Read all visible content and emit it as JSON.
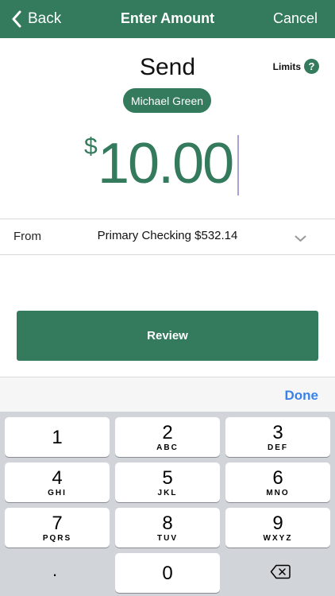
{
  "header": {
    "back_label": "Back",
    "title": "Enter Amount",
    "cancel_label": "Cancel"
  },
  "send": {
    "title": "Send",
    "limits_label": "Limits",
    "help_symbol": "?",
    "recipient": "Michael Green",
    "currency_symbol": "$",
    "amount": "10.00"
  },
  "from_row": {
    "label": "From",
    "account": "Primary Checking $532.14"
  },
  "review_label": "Review",
  "keyboard": {
    "done_label": "Done",
    "keys": [
      {
        "num": "1",
        "letters": ""
      },
      {
        "num": "2",
        "letters": "ABC"
      },
      {
        "num": "3",
        "letters": "DEF"
      },
      {
        "num": "4",
        "letters": "GHI"
      },
      {
        "num": "5",
        "letters": "JKL"
      },
      {
        "num": "6",
        "letters": "MNO"
      },
      {
        "num": "7",
        "letters": "PQRS"
      },
      {
        "num": "8",
        "letters": "TUV"
      },
      {
        "num": "9",
        "letters": "WXYZ"
      },
      {
        "num": "0",
        "letters": ""
      }
    ],
    "decimal_key": "."
  },
  "colors": {
    "brand_green": "#347a5d",
    "done_blue": "#3b82e6",
    "keypad_bg": "#d1d4d9"
  },
  "icons": [
    "chevron-left-icon",
    "help-icon",
    "chevron-down-icon",
    "backspace-icon"
  ]
}
